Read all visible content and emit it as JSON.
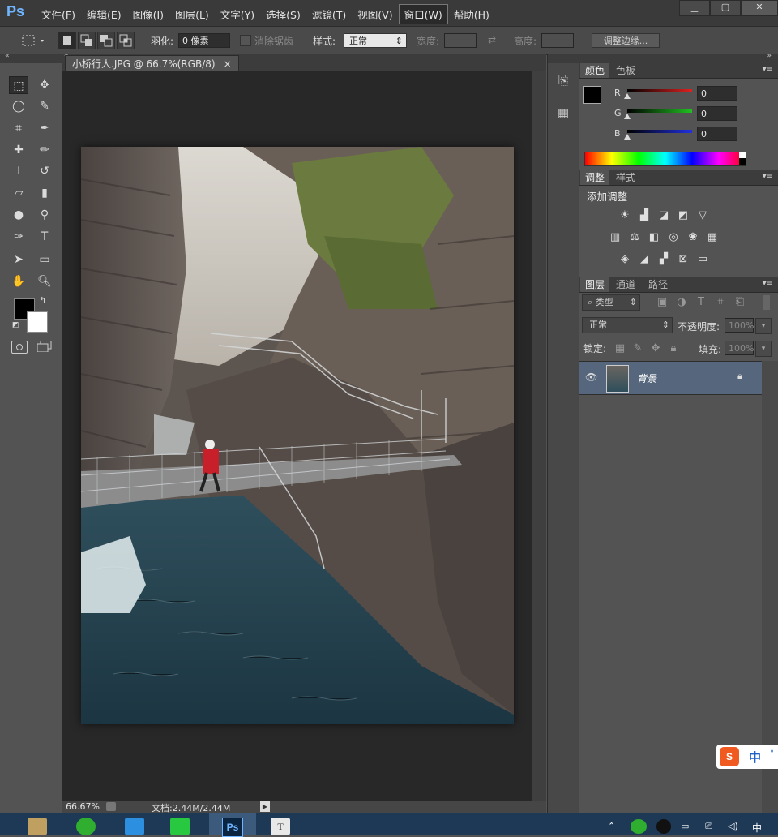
{
  "app": {
    "logo": "Ps"
  },
  "menu": [
    "文件(F)",
    "编辑(E)",
    "图像(I)",
    "图层(L)",
    "文字(Y)",
    "选择(S)",
    "滤镜(T)",
    "视图(V)",
    "窗口(W)",
    "帮助(H)"
  ],
  "menu_active_index": 8,
  "window_controls": {
    "minimize": "▁",
    "maximize": "▢",
    "close": "✕"
  },
  "options": {
    "feather_label": "羽化:",
    "feather_value": "0 像素",
    "antialias_label": "消除锯齿",
    "style_label": "样式:",
    "style_value": "正常",
    "width_label": "宽度:",
    "height_label": "高度:",
    "refine_edge_button": "调整边缘..."
  },
  "document": {
    "tab_title": "小桥行人.JPG @ 66.7%(RGB/8)",
    "tab_close": "×",
    "zoom": "66.67%",
    "doc_info": "文档:2.44M/2.44M"
  },
  "tools": {
    "icons": [
      "marquee-icon",
      "move-icon",
      "lasso-icon",
      "quick-select-icon",
      "crop-icon",
      "eyedropper-icon",
      "healing-icon",
      "brush-icon",
      "stamp-icon",
      "history-brush-icon",
      "eraser-icon",
      "gradient-icon",
      "blur-icon",
      "dodge-icon",
      "pen-icon",
      "type-icon",
      "path-select-icon",
      "rectangle-icon",
      "hand-icon",
      "zoom-icon"
    ],
    "foreground_color": "#000000",
    "background_color": "#ffffff"
  },
  "color_panel": {
    "tabs": [
      "颜色",
      "色板"
    ],
    "channels": [
      {
        "label": "R",
        "value": "0",
        "color": "#e02020"
      },
      {
        "label": "G",
        "value": "0",
        "color": "#20c020"
      },
      {
        "label": "B",
        "value": "0",
        "color": "#2030e0"
      }
    ]
  },
  "adjust_panel": {
    "tabs": [
      "调整",
      "样式"
    ],
    "heading": "添加调整"
  },
  "layers_panel": {
    "tabs": [
      "图层",
      "通道",
      "路径"
    ],
    "filter_label": "类型",
    "blend_mode": "正常",
    "opacity_label": "不透明度:",
    "opacity_value": "100%",
    "lock_label": "锁定:",
    "fill_label": "填充:",
    "fill_value": "100%",
    "layers": [
      {
        "name": "背景",
        "locked": true,
        "visible": true
      }
    ]
  },
  "ime": {
    "label": "中"
  }
}
